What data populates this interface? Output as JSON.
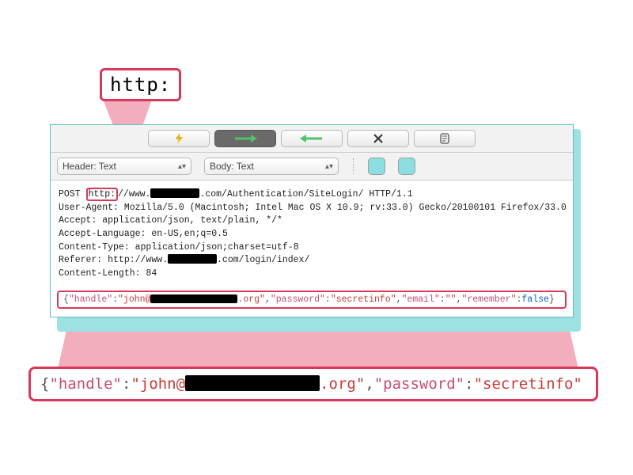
{
  "callouts": {
    "top": "http:",
    "bottom_open": "{",
    "bottom_k_handle": "\"handle\"",
    "bottom_colon": ":",
    "bottom_v_handle_pre": "\"john@",
    "bottom_v_handle_post": ".org\"",
    "bottom_comma": ",",
    "bottom_k_pass": "\"password\"",
    "bottom_v_pass": "\"secretinfo\""
  },
  "toolbar": {
    "dropdown_header": "Header: Text",
    "dropdown_body": "Body: Text"
  },
  "request": {
    "line1_pre": "POST ",
    "line1_http": "http:",
    "line1_mid": "//www.",
    "line1_post": ".com/Authentication/SiteLogin/ HTTP/1.1",
    "line2": "User-Agent: Mozilla/5.0 (Macintosh; Intel Mac OS X 10.9; rv:33.0) Gecko/20100101 Firefox/33.0",
    "line3": "Accept: application/json, text/plain, */*",
    "line4": "Accept-Language: en-US,en;q=0.5",
    "line5": "Content-Type: application/json;charset=utf-8",
    "line6_pre": "Referer: http://www.",
    "line6_post": ".com/login/index/",
    "line7": "Content-Length: 84"
  },
  "body_json": {
    "open": "{",
    "k_handle": "\"handle\"",
    "v_handle_pre": "\"john@",
    "v_handle_post": ".org\"",
    "k_password": "\"password\"",
    "v_password": "\"secretinfo\"",
    "k_email": "\"email\"",
    "v_email": "\"\"",
    "k_remember": "\"remember\"",
    "v_remember": "false",
    "colon": ":",
    "comma": ",",
    "close": "}"
  },
  "colors": {
    "highlight": "#d63a5a",
    "panel_border": "#5fbfc2",
    "shadow": "#9de1e3"
  }
}
